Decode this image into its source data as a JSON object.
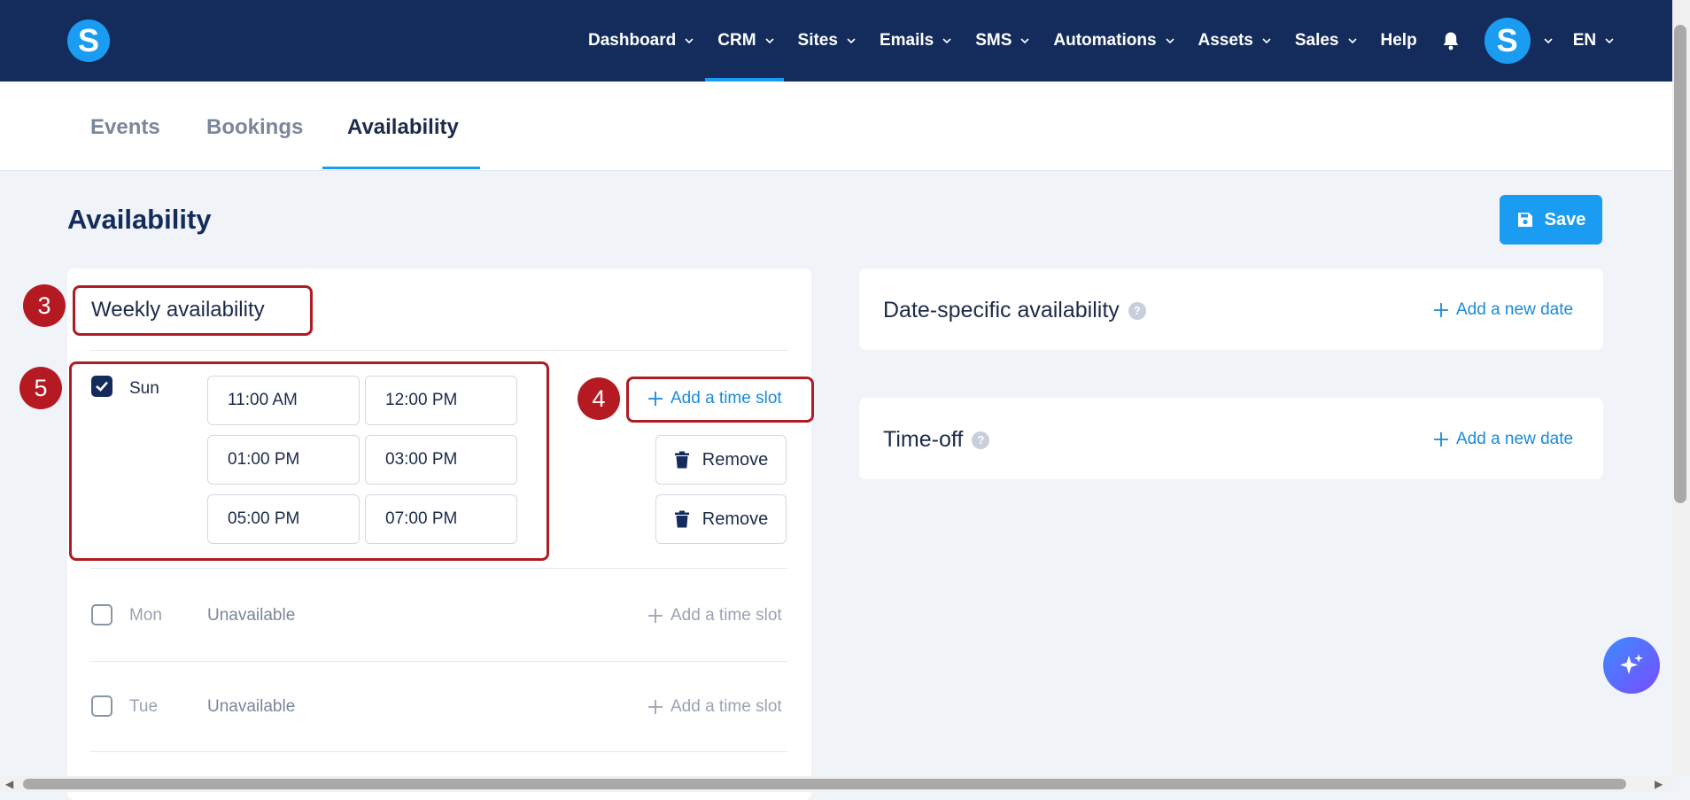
{
  "nav": {
    "items": [
      {
        "label": "Dashboard",
        "dropdown": true
      },
      {
        "label": "CRM",
        "dropdown": true,
        "active": true
      },
      {
        "label": "Sites",
        "dropdown": true
      },
      {
        "label": "Emails",
        "dropdown": true
      },
      {
        "label": "SMS",
        "dropdown": true
      },
      {
        "label": "Automations",
        "dropdown": true
      },
      {
        "label": "Assets",
        "dropdown": true
      },
      {
        "label": "Sales",
        "dropdown": true
      },
      {
        "label": "Help",
        "dropdown": false
      }
    ],
    "logo_letter": "S",
    "avatar_letter": "S",
    "language": "EN"
  },
  "tabs": {
    "events": "Events",
    "bookings": "Bookings",
    "availability": "Availability"
  },
  "page": {
    "title": "Availability",
    "save_label": "Save"
  },
  "weekly": {
    "title": "Weekly availability",
    "add_slot_label": "Add a time slot",
    "remove_label": "Remove",
    "days": [
      {
        "label": "Sun",
        "checked": true,
        "slots": [
          [
            "11:00 AM",
            "12:00 PM"
          ],
          [
            "01:00 PM",
            "03:00 PM"
          ],
          [
            "05:00 PM",
            "07:00 PM"
          ]
        ]
      },
      {
        "label": "Mon",
        "checked": false,
        "status": "Unavailable"
      },
      {
        "label": "Tue",
        "checked": false,
        "status": "Unavailable"
      }
    ]
  },
  "date_specific": {
    "title": "Date-specific availability",
    "add_label": "Add a new date"
  },
  "time_off": {
    "title": "Time-off",
    "add_label": "Add a new date"
  },
  "annotations": [
    "3",
    "4",
    "5"
  ],
  "colors": {
    "nav_bg": "#142c5c",
    "accent": "#1a9cf2",
    "annotation": "#b01c23"
  }
}
